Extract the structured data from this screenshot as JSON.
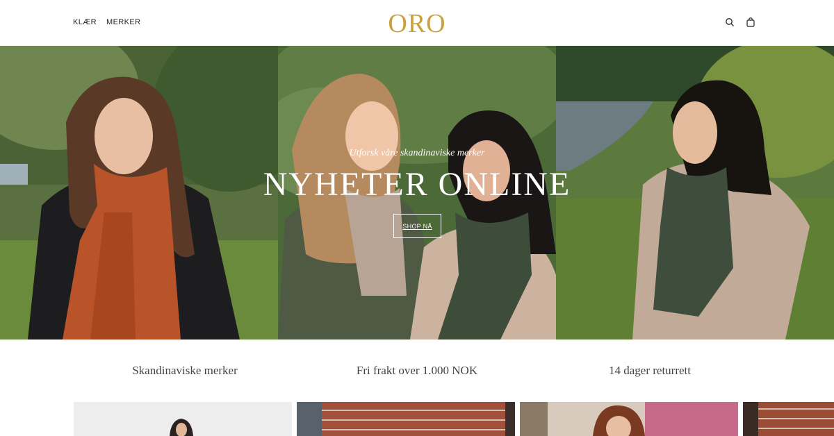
{
  "header": {
    "nav": [
      {
        "label": "KLÆR"
      },
      {
        "label": "MERKER"
      }
    ],
    "logo": "ORO",
    "icons": [
      "search-icon",
      "bag-icon"
    ]
  },
  "hero": {
    "subtitle": "Utforsk våre skandinaviske merker",
    "title": "NYHETER ONLINE",
    "cta_label": "SHOP NÅ"
  },
  "usps": [
    {
      "text": "Skandinaviske merker"
    },
    {
      "text": "Fri frakt over 1.000 NOK"
    },
    {
      "text": "14 dager returrett"
    }
  ],
  "colors": {
    "logo": "#c9a23c",
    "text": "#222222",
    "usp_text": "#444444"
  }
}
